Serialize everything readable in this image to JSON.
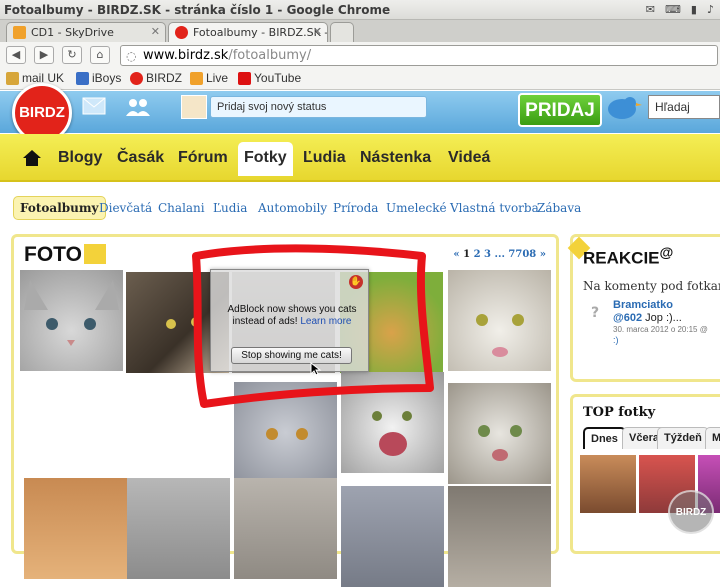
{
  "window": {
    "title": "Fotoalbumy - BIRDZ.SK - stránka číslo 1 - Google Chrome"
  },
  "tray": {
    "battery_time": "",
    "volume": ""
  },
  "tabs": [
    {
      "label": "CD1 - SkyDrive"
    },
    {
      "label": "Fotoalbumy - BIRDZ.SK - st"
    }
  ],
  "address": {
    "host": "www.birdz.sk",
    "path": "/fotoalbumy/"
  },
  "bookmarks": [
    {
      "label": "mail UK"
    },
    {
      "label": "iBoys"
    },
    {
      "label": "BIRDZ"
    },
    {
      "label": "Live"
    },
    {
      "label": "YouTube"
    }
  ],
  "site": {
    "logo": "BIRDZ",
    "status_placeholder": "Pridaj svoj nový status",
    "pridaj": "PRIDAJ",
    "search_placeholder": "Hľadaj"
  },
  "nav": [
    {
      "label": "Blogy"
    },
    {
      "label": "Časák"
    },
    {
      "label": "Fórum"
    },
    {
      "label": "Fotky"
    },
    {
      "label": "Ľudia"
    },
    {
      "label": "Nástenka"
    },
    {
      "label": "Videá"
    }
  ],
  "subnav": [
    {
      "label": "Fotoalbumy"
    },
    {
      "label": "Dievčatá"
    },
    {
      "label": "Chalani"
    },
    {
      "label": "Ľudia"
    },
    {
      "label": "Automobily"
    },
    {
      "label": "Príroda"
    },
    {
      "label": "Umelecké"
    },
    {
      "label": "Vlastná tvorba"
    },
    {
      "label": "Zábava"
    }
  ],
  "foto": {
    "title": "FOTO",
    "pager": {
      "prev": "«",
      "p1": "1",
      "p2": "2",
      "p3": "3",
      "dots": "...",
      "last": "7708",
      "next": "»"
    }
  },
  "reakcie": {
    "title": "REAKCIE",
    "sup": "@",
    "subtitle": "Na komenty pod fotkami",
    "user": "Bramciatko",
    "mention": "@602",
    "comment": " Jop :)...",
    "date": "30. marca 2012 o 20:15 @",
    "more": ":)"
  },
  "topfotky": {
    "title": "TOP fotky",
    "tabs": [
      {
        "label": "Dnes"
      },
      {
        "label": "Včera"
      },
      {
        "label": "Týždeň"
      },
      {
        "label": "Mi"
      }
    ]
  },
  "adblock": {
    "message": "AdBlock now shows you cats instead of ads!",
    "learn_more": "Learn more",
    "button": "Stop showing me cats!"
  },
  "watermark": "BIRDZ",
  "colors": {
    "brand_red": "#e2231a",
    "nav_yellow": "#f4ee55",
    "link_blue": "#2a6bb3",
    "scribble_red": "#e8141a"
  }
}
